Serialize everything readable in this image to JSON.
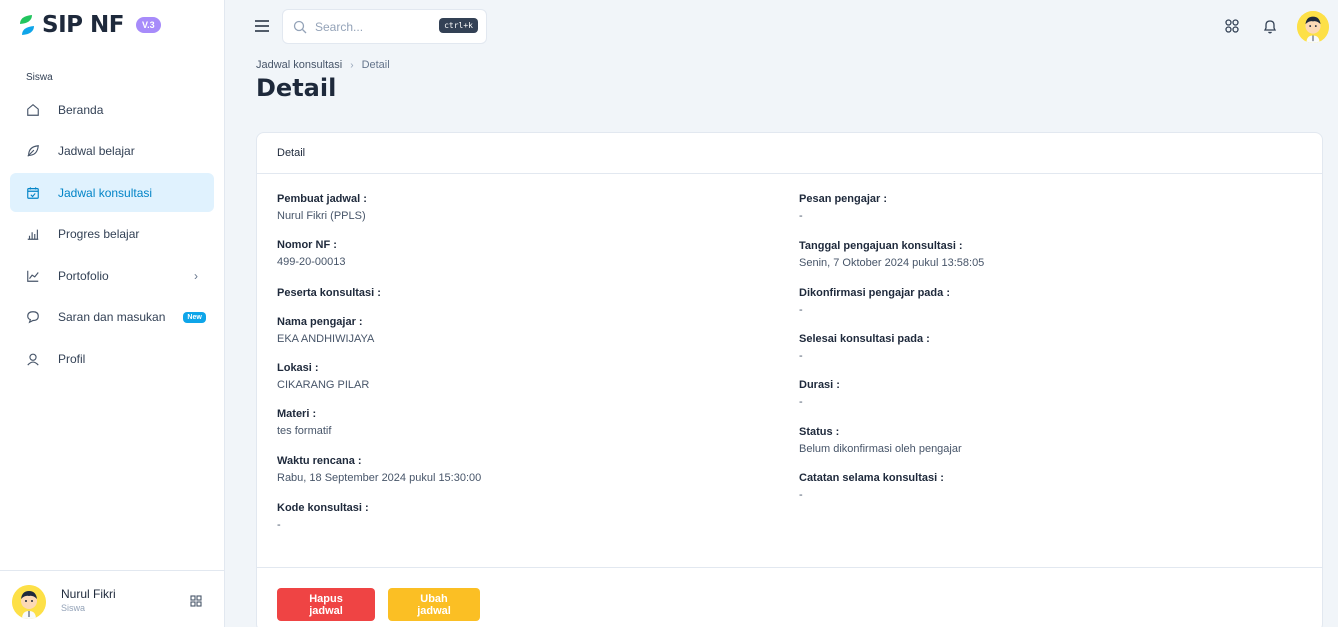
{
  "app": {
    "name": "SIP NF",
    "version": "V.3"
  },
  "sidebar": {
    "section": "Siswa",
    "items": [
      {
        "label": "Beranda",
        "icon": "home-icon"
      },
      {
        "label": "Jadwal belajar",
        "icon": "leaf-icon"
      },
      {
        "label": "Jadwal konsultasi",
        "icon": "calendar-check-icon",
        "active": true
      },
      {
        "label": "Progres belajar",
        "icon": "bar-chart-icon"
      },
      {
        "label": "Portofolio",
        "icon": "line-chart-icon",
        "chevron": "›"
      },
      {
        "label": "Saran dan masukan",
        "icon": "chat-icon",
        "badge": "New"
      },
      {
        "label": "Profil",
        "icon": "user-icon"
      }
    ],
    "user": {
      "name": "Nurul Fikri",
      "role": "Siswa"
    }
  },
  "header": {
    "search_placeholder": "Search...",
    "shortcut": "ctrl+k"
  },
  "breadcrumb": {
    "parent": "Jadwal konsultasi",
    "separator": "›",
    "current": "Detail"
  },
  "page_title": "Detail",
  "card": {
    "title": "Detail",
    "left": [
      {
        "label": "Pembuat jadwal :",
        "value": "Nurul Fikri (PPLS)"
      },
      {
        "label": "Nomor NF :",
        "value": "499-20-00013"
      },
      {
        "label": "Peserta konsultasi :",
        "value": ""
      },
      {
        "label": "Nama pengajar :",
        "value": "EKA ANDHIWIJAYA"
      },
      {
        "label": "Lokasi :",
        "value": "CIKARANG PILAR"
      },
      {
        "label": "Materi :",
        "value": "tes formatif"
      },
      {
        "label": "Waktu rencana :",
        "value": "Rabu, 18 September 2024 pukul 15:30:00"
      },
      {
        "label": "Kode konsultasi :",
        "value": "-"
      }
    ],
    "right": [
      {
        "label": "Pesan pengajar :",
        "value": "-"
      },
      {
        "label": "Tanggal pengajuan konsultasi :",
        "value": "Senin, 7 Oktober 2024 pukul 13:58:05"
      },
      {
        "label": "Dikonfirmasi pengajar pada :",
        "value": "-"
      },
      {
        "label": "Selesai konsultasi pada :",
        "value": "-"
      },
      {
        "label": "Durasi :",
        "value": "-"
      },
      {
        "label": "Status :",
        "value": "Belum dikonfirmasi oleh pengajar"
      },
      {
        "label": "Catatan selama konsultasi :",
        "value": "-"
      }
    ],
    "buttons": {
      "delete": "Hapus jadwal",
      "edit": "Ubah jadwal"
    }
  },
  "colors": {
    "accent": "#0284c7",
    "active_bg": "#e0f2fe",
    "danger": "#ef4444",
    "warning": "#fbbf24",
    "logo_green": "#22c55e"
  }
}
